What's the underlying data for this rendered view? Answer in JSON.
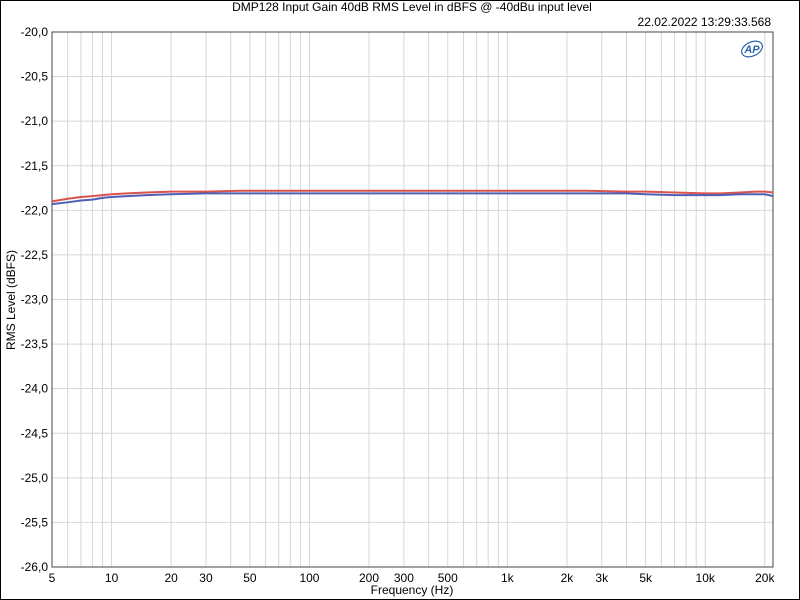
{
  "chart_data": {
    "type": "line",
    "title": "DMP128 Input Gain 40dB  RMS Level in dBFS @ -40dBu input level",
    "timestamp": "22.02.2022 13:29:33.568",
    "logo": "AP",
    "xlabel": "Frequency (Hz)",
    "ylabel": "RMS Level (dBFS)",
    "x_scale": "log",
    "xlim": [
      5,
      22000
    ],
    "ylim": [
      -26.0,
      -20.0
    ],
    "grid": true,
    "x_tick_values": [
      5,
      10,
      20,
      30,
      50,
      100,
      200,
      300,
      500,
      1000,
      2000,
      3000,
      5000,
      10000,
      20000
    ],
    "x_tick_labels": [
      "5",
      "10",
      "20",
      "30",
      "50",
      "100",
      "200",
      "300",
      "500",
      "1k",
      "2k",
      "3k",
      "5k",
      "10k",
      "20k"
    ],
    "y_tick_values": [
      -20.0,
      -20.5,
      -21.0,
      -21.5,
      -22.0,
      -22.5,
      -23.0,
      -23.5,
      -24.0,
      -24.5,
      -25.0,
      -25.5,
      -26.0
    ],
    "y_tick_labels": [
      "-20,0",
      "-20,5",
      "-21,0",
      "-21,5",
      "-22,0",
      "-22,5",
      "-23,0",
      "-23,5",
      "-24,0",
      "-24,5",
      "-25,0",
      "-25,5",
      "-26,0"
    ],
    "series": [
      {
        "color": "#d9534f",
        "x": [
          5,
          6,
          7,
          8,
          9,
          10,
          12,
          15,
          20,
          30,
          45,
          100,
          300,
          1000,
          2000,
          2500,
          4000,
          5000,
          7000,
          10000,
          12000,
          15000,
          18000,
          20000,
          22000
        ],
        "y": [
          -21.9,
          -21.87,
          -21.85,
          -21.84,
          -21.83,
          -21.82,
          -21.81,
          -21.8,
          -21.79,
          -21.79,
          -21.78,
          -21.78,
          -21.78,
          -21.78,
          -21.78,
          -21.78,
          -21.79,
          -21.79,
          -21.8,
          -21.81,
          -21.81,
          -21.8,
          -21.79,
          -21.79,
          -21.8
        ]
      },
      {
        "color": "#4f5fb5",
        "x": [
          5,
          6,
          7,
          8,
          9,
          10,
          12,
          15,
          20,
          30,
          45,
          100,
          300,
          1000,
          2000,
          3000,
          4000,
          5000,
          7000,
          10000,
          12000,
          15000,
          18000,
          20000,
          22000
        ],
        "y": [
          -21.93,
          -21.91,
          -21.89,
          -21.88,
          -21.86,
          -21.85,
          -21.84,
          -21.83,
          -21.82,
          -21.81,
          -21.81,
          -21.81,
          -21.81,
          -21.81,
          -21.81,
          -21.81,
          -21.81,
          -21.82,
          -21.83,
          -21.83,
          -21.83,
          -21.82,
          -21.82,
          -21.82,
          -21.84
        ]
      }
    ]
  }
}
